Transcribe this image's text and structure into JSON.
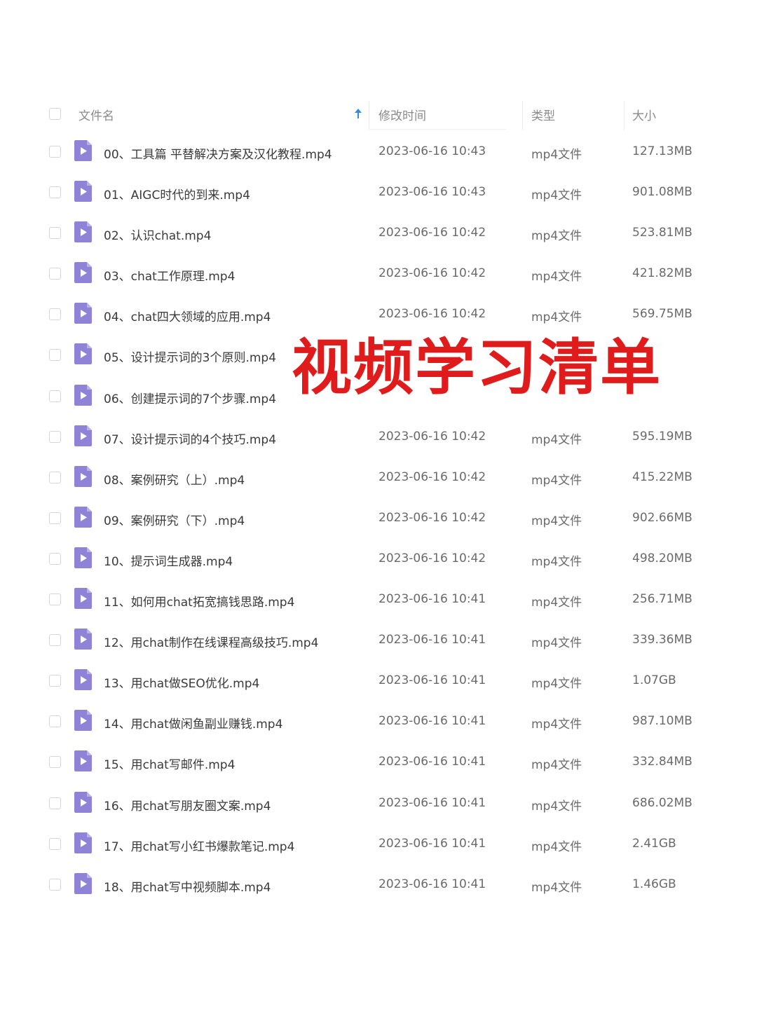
{
  "table": {
    "header": {
      "name_label": "文件名",
      "time_label": "修改时间",
      "type_label": "类型",
      "size_label": "大小"
    },
    "rows": [
      {
        "name": "00、工具篇 平替解决方案及汉化教程.mp4",
        "time": "2023-06-16 10:43",
        "type": "mp4文件",
        "size": "127.13MB"
      },
      {
        "name": "01、AIGC时代的到来.mp4",
        "time": "2023-06-16 10:43",
        "type": "mp4文件",
        "size": "901.08MB"
      },
      {
        "name": "02、认识chat.mp4",
        "time": "2023-06-16 10:42",
        "type": "mp4文件",
        "size": "523.81MB"
      },
      {
        "name": "03、chat工作原理.mp4",
        "time": "2023-06-16 10:42",
        "type": "mp4文件",
        "size": "421.82MB"
      },
      {
        "name": "04、chat四大领域的应用.mp4",
        "time": "2023-06-16 10:42",
        "type": "mp4文件",
        "size": "569.75MB"
      },
      {
        "name": "05、设计提示词的3个原则.mp4",
        "time": "",
        "type": "",
        "size": ""
      },
      {
        "name": "06、创建提示词的7个步骤.mp4",
        "time": "",
        "type": "",
        "size": ""
      },
      {
        "name": "07、设计提示词的4个技巧.mp4",
        "time": "2023-06-16 10:42",
        "type": "mp4文件",
        "size": "595.19MB"
      },
      {
        "name": "08、案例研究（上）.mp4",
        "time": "2023-06-16 10:42",
        "type": "mp4文件",
        "size": "415.22MB"
      },
      {
        "name": "09、案例研究（下）.mp4",
        "time": "2023-06-16 10:42",
        "type": "mp4文件",
        "size": "902.66MB"
      },
      {
        "name": "10、提示词生成器.mp4",
        "time": "2023-06-16 10:42",
        "type": "mp4文件",
        "size": "498.20MB"
      },
      {
        "name": "11、如何用chat拓宽搞钱思路.mp4",
        "time": "2023-06-16 10:41",
        "type": "mp4文件",
        "size": "256.71MB"
      },
      {
        "name": "12、用chat制作在线课程高级技巧.mp4",
        "time": "2023-06-16 10:41",
        "type": "mp4文件",
        "size": "339.36MB"
      },
      {
        "name": "13、用chat做SEO优化.mp4",
        "time": "2023-06-16 10:41",
        "type": "mp4文件",
        "size": "1.07GB"
      },
      {
        "name": "14、用chat做闲鱼副业赚钱.mp4",
        "time": "2023-06-16 10:41",
        "type": "mp4文件",
        "size": "987.10MB"
      },
      {
        "name": "15、用chat写邮件.mp4",
        "time": "2023-06-16 10:41",
        "type": "mp4文件",
        "size": "332.84MB"
      },
      {
        "name": "16、用chat写朋友圈文案.mp4",
        "time": "2023-06-16 10:41",
        "type": "mp4文件",
        "size": "686.02MB"
      },
      {
        "name": "17、用chat写小红书爆款笔记.mp4",
        "time": "2023-06-16 10:41",
        "type": "mp4文件",
        "size": "2.41GB"
      },
      {
        "name": "18、用chat写中视频脚本.mp4",
        "time": "2023-06-16 10:41",
        "type": "mp4文件",
        "size": "1.46GB"
      }
    ]
  },
  "overlay": {
    "title": "视频学习清单"
  },
  "colors": {
    "file_icon": "#8f83d8",
    "overlay_title": "#e01b1b",
    "sort_arrow": "#2f8ee0"
  },
  "icons": {
    "file_icon": "video-file-icon",
    "sort_icon": "sort-ascending-icon"
  }
}
